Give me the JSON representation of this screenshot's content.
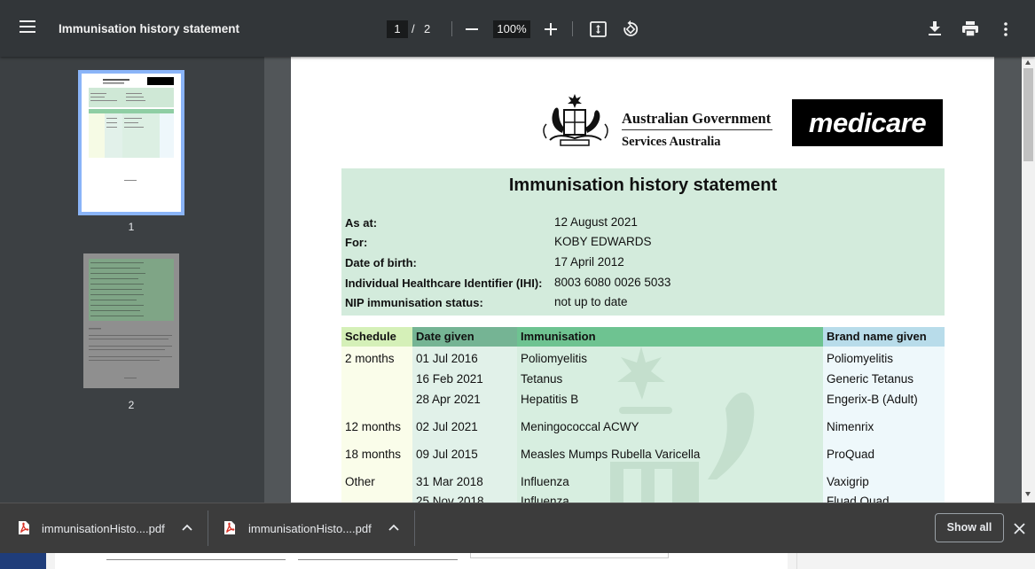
{
  "toolbar": {
    "title": "Immunisation history statement",
    "page_current": "1",
    "page_separator": "/",
    "page_total": "2",
    "zoom": "100%"
  },
  "sidebar": {
    "thumbnails": [
      {
        "label": "1",
        "selected": true
      },
      {
        "label": "2",
        "selected": false
      }
    ]
  },
  "document": {
    "logo_line1": "Australian Government",
    "logo_line2": "Services Australia",
    "brand": "medicare",
    "heading": "Immunisation history statement",
    "details": [
      {
        "label": "As at:",
        "value": "12 August 2021"
      },
      {
        "label": "For:",
        "value": "KOBY EDWARDS"
      },
      {
        "label": "Date of birth:",
        "value": "17 April 2012"
      },
      {
        "label": "Individual Healthcare Identifier (IHI):",
        "value": "8003 6080 0026 5033"
      },
      {
        "label": "NIP immunisation status:",
        "value": "not up to date"
      }
    ],
    "table": {
      "headers": [
        "Schedule",
        "Date given",
        "Immunisation",
        "Brand name given"
      ],
      "rows": [
        {
          "schedule": "2 months",
          "date": "01 Jul 2016",
          "immunisation": "Poliomyelitis",
          "brand": "Poliomyelitis"
        },
        {
          "schedule": "",
          "date": "16 Feb 2021",
          "immunisation": "Tetanus",
          "brand": "Generic Tetanus"
        },
        {
          "schedule": "",
          "date": "28 Apr 2021",
          "immunisation": "Hepatitis B",
          "brand": "Engerix-B (Adult)"
        },
        {
          "schedule": "12 months",
          "date": "02 Jul 2021",
          "immunisation": "Meningococcal ACWY",
          "brand": "Nimenrix"
        },
        {
          "schedule": "18 months",
          "date": "09 Jul 2015",
          "immunisation": "Measles Mumps Rubella Varicella",
          "brand": "ProQuad"
        },
        {
          "schedule": "Other",
          "date": "31 Mar 2018",
          "immunisation": "Influenza",
          "brand": "Vaxigrip"
        },
        {
          "schedule": "",
          "date": "25 Nov 2018",
          "immunisation": "Influenza",
          "brand": "Fluad Quad"
        }
      ]
    }
  },
  "downloads": {
    "items": [
      {
        "name": "immunisationHisto....pdf"
      },
      {
        "name": "immunisationHisto....pdf"
      }
    ],
    "show_all": "Show all"
  },
  "colors": {
    "toolbar_bg": "#323639",
    "sidebar_bg": "#3c4043",
    "viewer_bg": "#525659",
    "summary_bg": "#d3ebdc",
    "thumb_selected_border": "#8ab4f8",
    "downloads_bg": "#3c3c3c"
  },
  "icons": {
    "menu": "hamburger-icon",
    "fit": "fit-to-page-icon",
    "rotate": "rotate-icon",
    "download": "download-icon",
    "print": "print-icon",
    "more": "more-vert-icon",
    "pdf": "pdf-file-icon",
    "chevron": "chevron-up-icon",
    "close": "close-icon"
  }
}
